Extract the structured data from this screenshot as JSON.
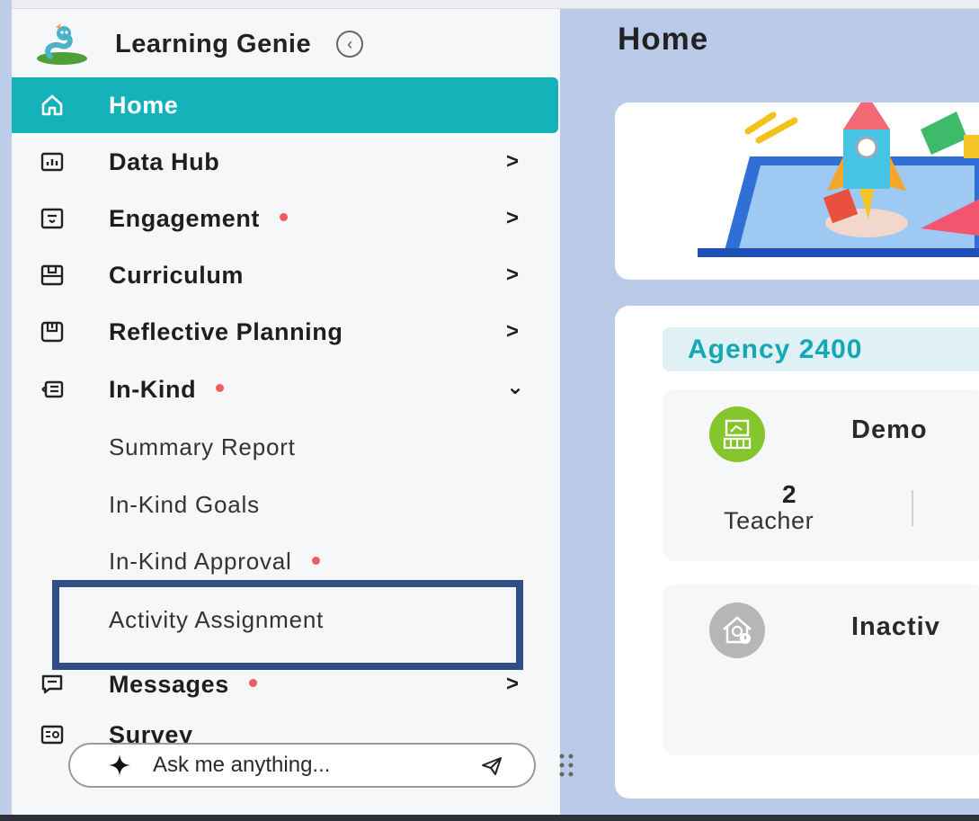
{
  "app": {
    "brand_name": "Learning Genie",
    "brand_logo_icon": "genie-logo-icon",
    "collapse_icon": "chevron-left-circle-icon"
  },
  "sidebar": {
    "items": [
      {
        "label": "Home",
        "icon": "home-icon",
        "active": true
      },
      {
        "label": "Data Hub",
        "icon": "bar-chart-icon",
        "chevron": ">"
      },
      {
        "label": "Engagement",
        "icon": "message-box-icon",
        "badge": true,
        "chevron": ">"
      },
      {
        "label": "Curriculum",
        "icon": "book-icon",
        "chevron": ">"
      },
      {
        "label": "Reflective Planning",
        "icon": "planner-icon",
        "chevron": ">"
      },
      {
        "label": "In-Kind",
        "icon": "in-kind-icon",
        "badge": true,
        "chevron": "⌄",
        "expanded": true
      },
      {
        "label": "Messages",
        "icon": "chat-icon",
        "badge": true,
        "chevron": ">"
      },
      {
        "label": "Survey",
        "icon": "survey-icon"
      }
    ],
    "in_kind_subitems": [
      {
        "label": "Summary Report"
      },
      {
        "label": "In-Kind Goals"
      },
      {
        "label": "In-Kind Approval",
        "badge": true
      },
      {
        "label": "Activity Assignment",
        "highlighted": true
      }
    ]
  },
  "assistant": {
    "placeholder": "Ask me anything...",
    "sparkle_icon": "sparkle-icon",
    "send_icon": "send-icon",
    "drag_icon": "drag-handle-icon"
  },
  "main": {
    "title": "Home",
    "banner_image": "rocket-launch-illustration",
    "agency_name": "Agency 2400",
    "demo_card": {
      "title": "Demo",
      "icon": "classroom-icon",
      "stat_value": "2",
      "stat_label": "Teacher"
    },
    "inactive_card": {
      "title": "Inactiv",
      "icon": "inactive-school-icon"
    }
  },
  "colors": {
    "accent": "#16b2ba",
    "badge": "#f25c61",
    "highlight_box": "#2f4e86",
    "demo_icon_bg": "#86c62d",
    "inactive_icon_bg": "#b6b6b6"
  }
}
